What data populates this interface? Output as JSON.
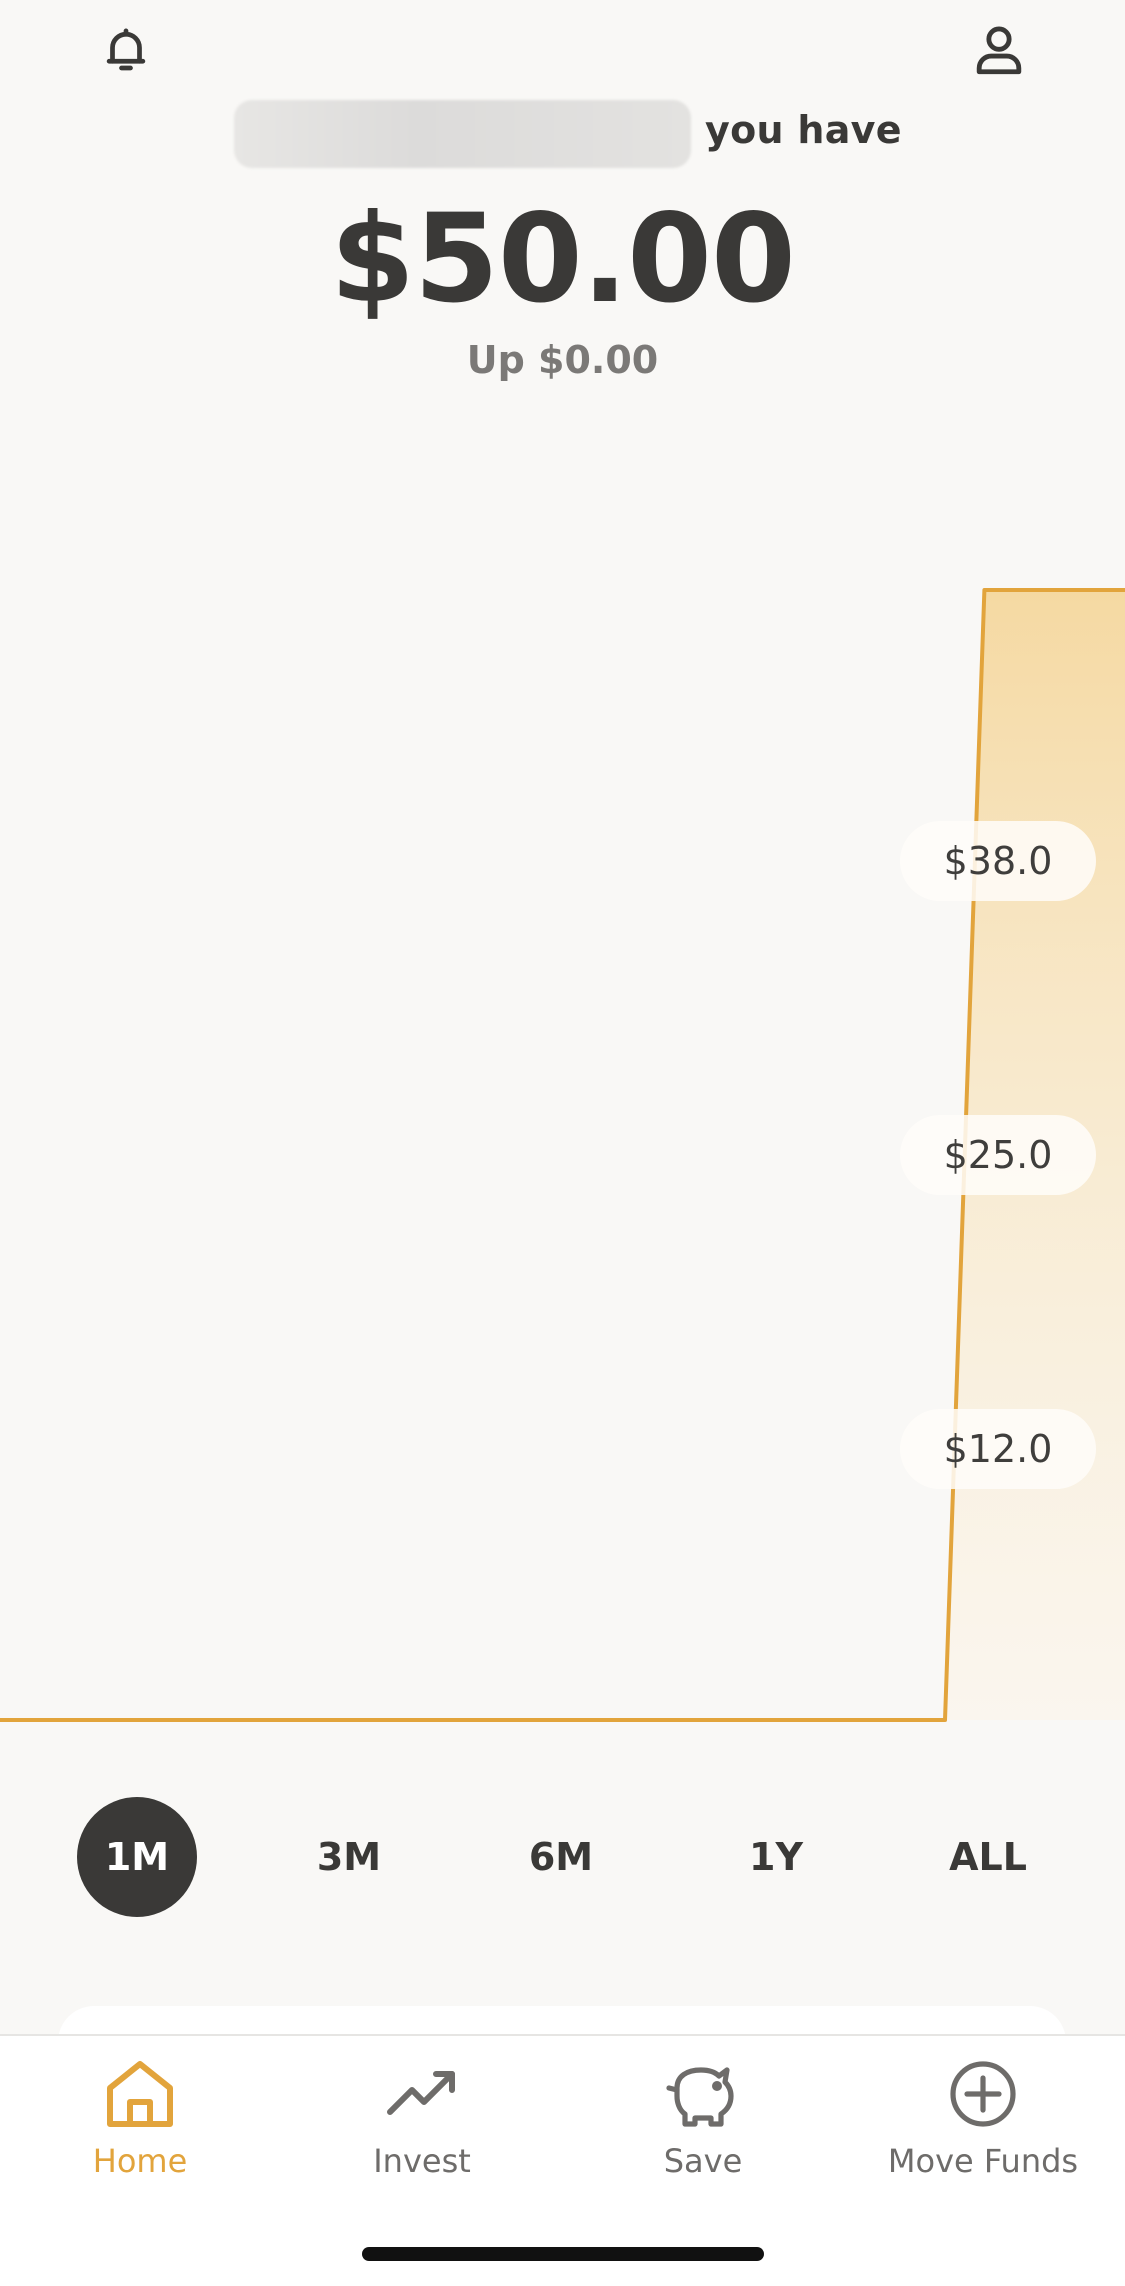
{
  "header": {
    "you_have": "you have",
    "balance": "$50.00",
    "change": "Up $0.00"
  },
  "chart_data": {
    "type": "area",
    "y_tick_labels": [
      "$38.0",
      "$25.0",
      "$12.0"
    ],
    "y_ticks": [
      38,
      25,
      12
    ],
    "ylim": [
      0,
      50
    ],
    "x": [
      0,
      0.84,
      0.875,
      1.0
    ],
    "values": [
      0,
      0,
      50,
      50
    ],
    "grid": false,
    "colors": {
      "line": "#e2a43c",
      "fill_top": "#f5d9a2",
      "fill_bottom": "#fbf1df"
    }
  },
  "ranges": {
    "items": [
      "1M",
      "3M",
      "6M",
      "1Y",
      "ALL"
    ],
    "active": "1M"
  },
  "nav": {
    "items": [
      {
        "label": "Home",
        "icon": "home-icon"
      },
      {
        "label": "Invest",
        "icon": "trend-up-icon"
      },
      {
        "label": "Save",
        "icon": "piggy-bank-icon"
      },
      {
        "label": "Move Funds",
        "icon": "plus-circle-icon"
      }
    ],
    "active": "Home",
    "accent_color": "#e2a43c"
  }
}
